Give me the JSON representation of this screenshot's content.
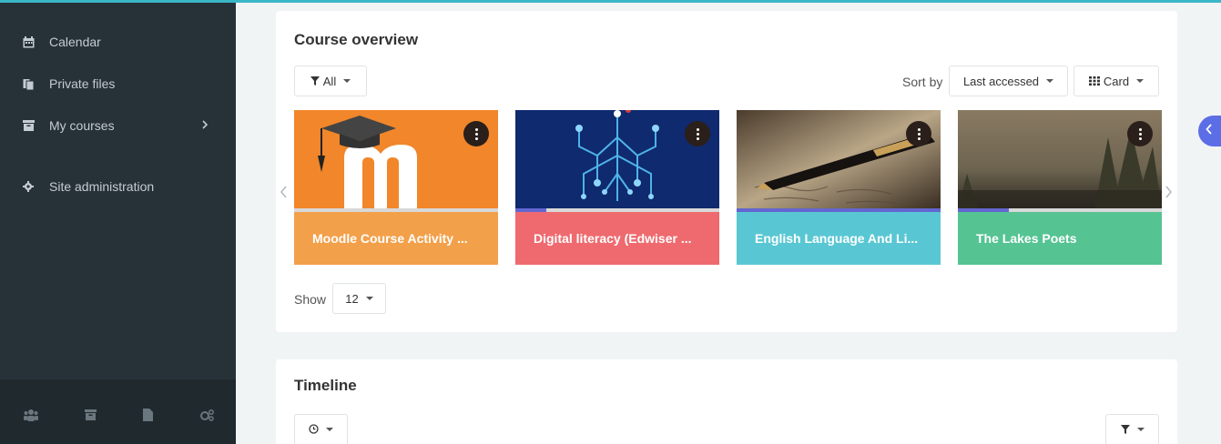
{
  "sidebar": {
    "items": [
      {
        "label": "Calendar",
        "icon": "calendar-icon"
      },
      {
        "label": "Private files",
        "icon": "files-icon"
      },
      {
        "label": "My courses",
        "icon": "archive-icon"
      },
      {
        "label": "Site administration",
        "icon": "gear-icon"
      }
    ],
    "bottom_icons": [
      "users-icon",
      "archive-icon",
      "file-icon",
      "cogs-icon"
    ]
  },
  "course_overview": {
    "title": "Course overview",
    "filter_label": "All",
    "sort_label": "Sort by",
    "sort_value": "Last accessed",
    "view_value": "Card",
    "show_label": "Show",
    "show_value": "12",
    "courses": [
      {
        "name": "Moodle Course Activity ...",
        "color": "#f3a04a",
        "progress": 0
      },
      {
        "name": "Digital literacy (Edwiser ...",
        "color": "#ef6a6f",
        "progress": 0.15
      },
      {
        "name": "English Language And Li...",
        "color": "#59c7d3",
        "progress": 1
      },
      {
        "name": "The Lakes Poets",
        "color": "#55c392",
        "progress": 0.25
      }
    ]
  },
  "timeline": {
    "title": "Timeline"
  },
  "colors": {
    "accent": "#3ab7c6",
    "sidebar_bg": "#263238",
    "drawer_toggle": "#5c6ee6"
  }
}
